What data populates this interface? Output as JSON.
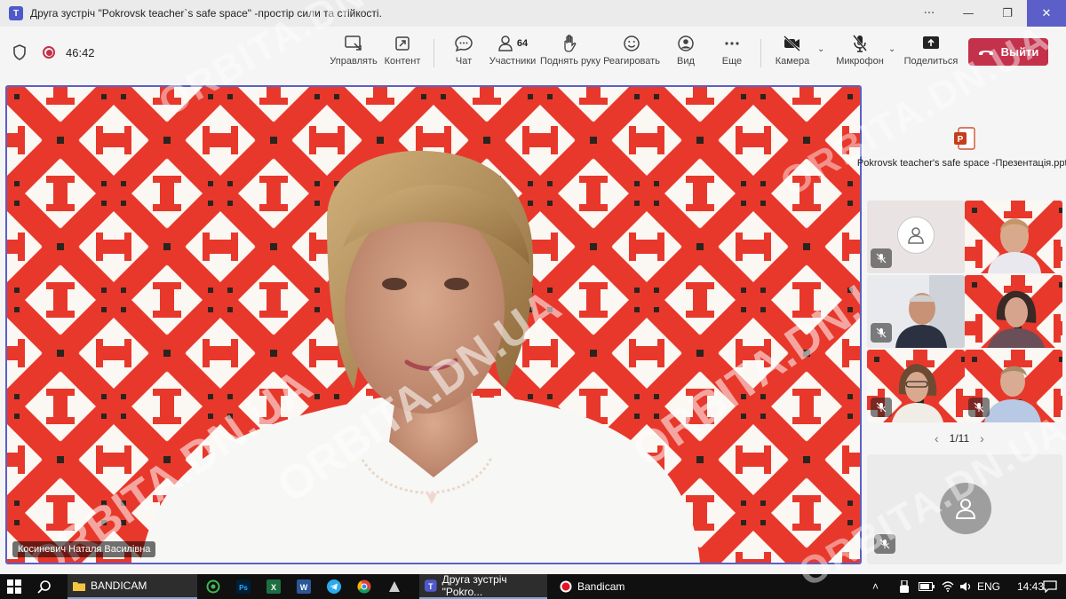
{
  "window": {
    "title": "Друга зустріч \"Pokrovsk teacher`s safe space\" -простір сили та стійкості.",
    "controls": {
      "more": "···",
      "minimize": "—",
      "restore": "❐",
      "close": "✕"
    }
  },
  "toolbar": {
    "elapsed_time": "46:42",
    "items": {
      "manage": "Управлять",
      "content": "Контент",
      "chat": "Чат",
      "participants": "Участники",
      "participants_count": "64",
      "raise_hand": "Поднять руку",
      "react": "Реагировать",
      "view": "Вид",
      "more": "Еще",
      "camera": "Камера",
      "microphone": "Микрофон",
      "share": "Поделиться"
    },
    "leave_label": "Выйти"
  },
  "main_video": {
    "speaker_name": "Косиневич Наталя Василівна"
  },
  "right_panel": {
    "shared_file": "Pokrovsk teacher's safe space -Презентація.pptx",
    "pager": {
      "prev": "‹",
      "text": "1/11",
      "next": "›"
    }
  },
  "taskbar": {
    "items": [
      {
        "label": "BANDICAM"
      },
      {
        "label": "Друга зустріч \"Pokro..."
      },
      {
        "label": "Bandicam"
      }
    ],
    "language": "ENG",
    "clock": "14:43"
  },
  "watermark": "ORBITA.DN.UA",
  "colors": {
    "accent": "#5b5fc7",
    "leave": "#c4314b",
    "embroidery_red": "#e8382b",
    "embroidery_black": "#2a2420"
  }
}
